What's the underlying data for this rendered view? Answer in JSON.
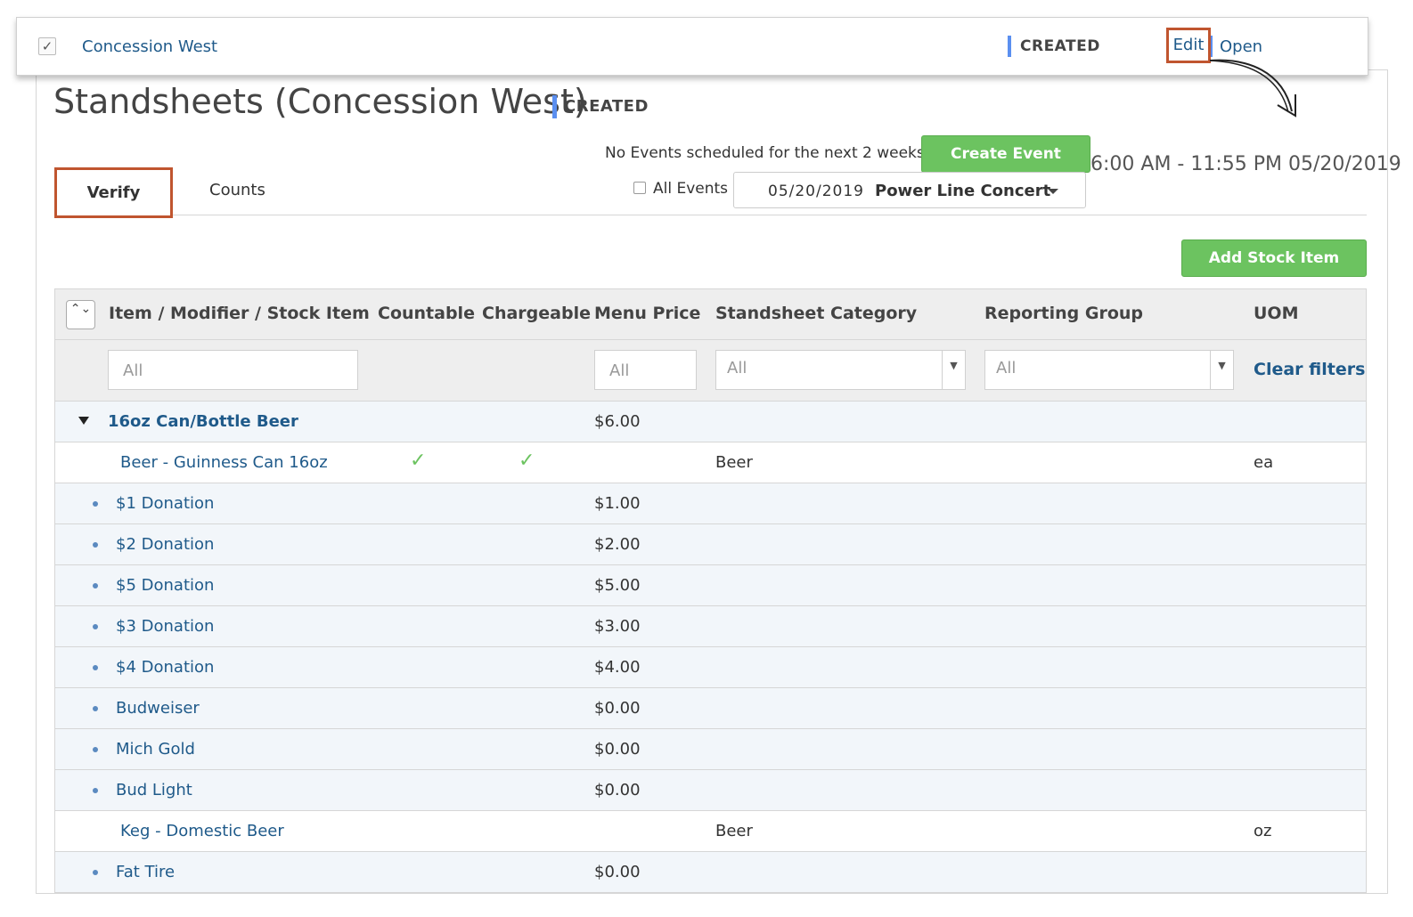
{
  "top_row": {
    "checkbox": "✓",
    "name": "Concession West",
    "status": "CREATED",
    "edit_label": "Edit",
    "open_label": "Open"
  },
  "page": {
    "title": "Standsheets (Concession West)",
    "status": "CREATED"
  },
  "events": {
    "notice": "No Events scheduled for the next 2 weeks",
    "create_label": "Create Event",
    "time_range": "6:00 AM - 11:55 PM 05/20/2019",
    "all_events_label": "All Events",
    "selected_date": "05/20/2019",
    "selected_event": "Power Line Concert"
  },
  "tabs": [
    {
      "label": "Verify",
      "active": true
    },
    {
      "label": "Counts",
      "active": false
    }
  ],
  "add_stock_label": "Add Stock Item",
  "table": {
    "sort_icon": "⌃⌄",
    "headers": {
      "item": "Item / Modifier / Stock Item",
      "countable": "Countable",
      "chargeable": "Chargeable",
      "menu_price": "Menu Price",
      "category": "Standsheet Category",
      "reporting": "Reporting Group",
      "uom": "UOM"
    },
    "filters": {
      "item": "All",
      "price": "All",
      "category": "All",
      "reporting": "All",
      "clear": "Clear filters"
    },
    "rows": [
      {
        "type": "group",
        "name": "16oz Can/Bottle Beer",
        "price": "$6.00",
        "category": "",
        "uom": ""
      },
      {
        "type": "stock",
        "name": "Beer - Guinness Can 16oz",
        "countable": "✓",
        "chargeable": "✓",
        "price": "",
        "category": "Beer",
        "uom": "ea"
      },
      {
        "type": "mod",
        "name": "$1 Donation",
        "price": "$1.00"
      },
      {
        "type": "mod",
        "name": "$2 Donation",
        "price": "$2.00"
      },
      {
        "type": "mod",
        "name": "$5 Donation",
        "price": "$5.00"
      },
      {
        "type": "mod",
        "name": "$3 Donation",
        "price": "$3.00"
      },
      {
        "type": "mod",
        "name": "$4 Donation",
        "price": "$4.00"
      },
      {
        "type": "mod",
        "name": "Budweiser",
        "price": "$0.00"
      },
      {
        "type": "mod",
        "name": "Mich Gold",
        "price": "$0.00"
      },
      {
        "type": "mod",
        "name": "Bud Light",
        "price": "$0.00"
      },
      {
        "type": "stock",
        "name": "Keg - Domestic Beer",
        "price": "",
        "category": "Beer",
        "uom": "oz"
      },
      {
        "type": "mod",
        "name": "Fat Tire",
        "price": "$0.00"
      }
    ]
  },
  "colors": {
    "accent_green": "#6cc360",
    "link_blue": "#1f5a8a",
    "status_bar": "#5b8ff0",
    "highlight": "#c0552f"
  }
}
